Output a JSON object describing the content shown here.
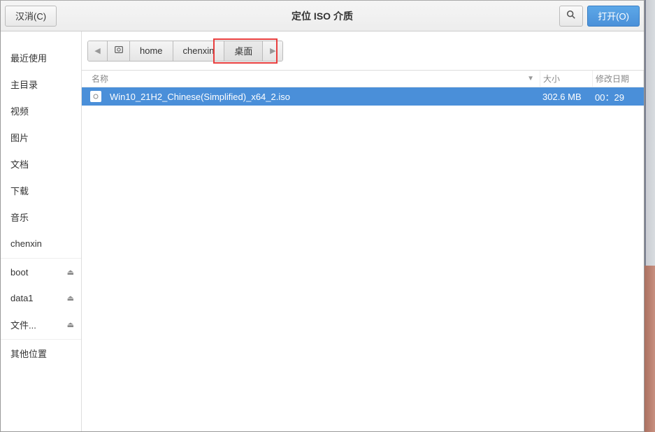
{
  "header": {
    "cancel_label": "汉消(C)",
    "title": "定位 ISO 介质",
    "open_label": "打开(O)"
  },
  "sidebar": {
    "items": [
      {
        "label": "最近使用",
        "eject": false
      },
      {
        "label": "主目录",
        "eject": false
      },
      {
        "label": "视频",
        "eject": false
      },
      {
        "label": "图片",
        "eject": false
      },
      {
        "label": "文档",
        "eject": false
      },
      {
        "label": "下载",
        "eject": false
      },
      {
        "label": "音乐",
        "eject": false
      },
      {
        "label": "chenxin",
        "eject": false
      },
      {
        "label": "boot",
        "eject": true,
        "sep": true
      },
      {
        "label": "data1",
        "eject": true
      },
      {
        "label": "文件...",
        "eject": true
      },
      {
        "label": "其他位置",
        "eject": false,
        "sep": true
      }
    ]
  },
  "breadcrumb": {
    "back": "◀",
    "forward": "▶",
    "items": [
      {
        "label": "home"
      },
      {
        "label": "chenxin"
      },
      {
        "label": "桌面",
        "active": true
      }
    ]
  },
  "columns": {
    "name": "名称",
    "size": "大小",
    "date": "修改日期",
    "sort_arrow": "▼"
  },
  "files": [
    {
      "name": "Win10_21H2_Chinese(Simplified)_x64_2.iso",
      "size": "302.6 MB",
      "date": "00：29",
      "selected": true
    }
  ]
}
